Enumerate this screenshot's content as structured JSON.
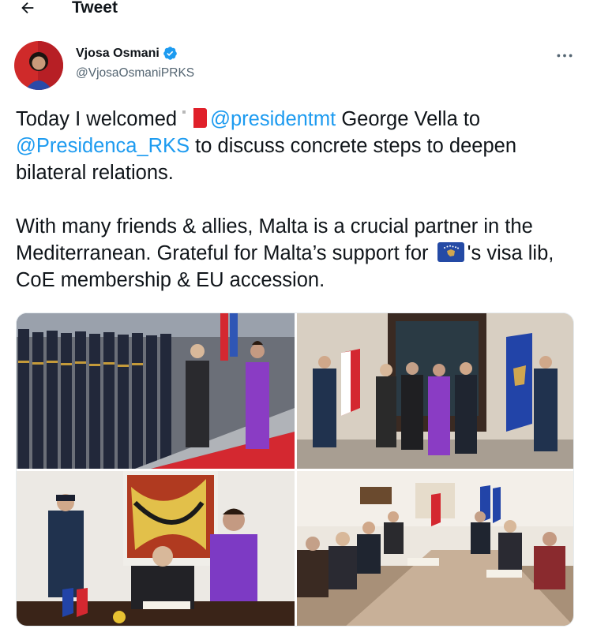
{
  "header": {
    "title": "Tweet"
  },
  "author": {
    "name": "Vjosa Osmani",
    "handle": "@VjosaOsmaniPRKS"
  },
  "tweet": {
    "line1_a": "Today I welcomed",
    "mention1": "@presidentmt",
    "line1_b": "George Vella to",
    "mention2": "@Presidenca_RKS",
    "line2_b": "to discuss concrete steps to deepen bilateral relations.",
    "para2_a": "With many friends & allies, Malta is a crucial partner in the Mediterranean. Grateful for Malta’s support for",
    "para2_b": "'s visa lib, CoE membership & EU accession."
  },
  "icons": {
    "back": "arrow-left-icon",
    "verified": "verified-badge-icon",
    "more": "ellipsis-icon",
    "flag_malta": "malta-flag-icon",
    "flag_kosovo": "kosovo-flag-icon"
  },
  "colors": {
    "link": "#1d9bf0",
    "text": "#0f1419",
    "muted": "#536471",
    "verified": "#1d9bf0"
  }
}
